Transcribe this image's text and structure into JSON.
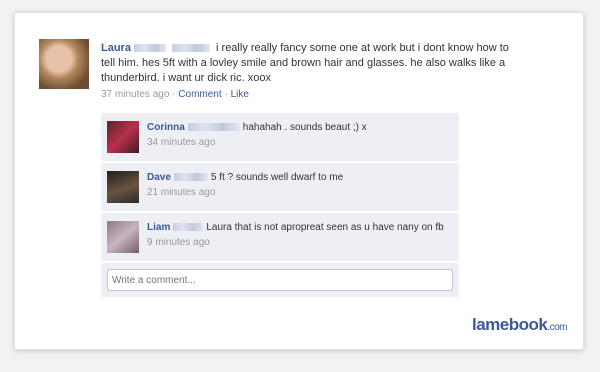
{
  "post": {
    "author": "Laura",
    "text": "i really really fancy some one at work but i dont know how to tell him. hes 5ft with a lovley smile and brown hair and glasses. he also walks like a thunderbird. i want ur dick ric. xoox",
    "time": "37 minutes ago",
    "separator": "·",
    "comment_link": "Comment",
    "like_link": "Like"
  },
  "comments": [
    {
      "author": "Corinna",
      "text": "hahahah . sounds beaut ;) x",
      "time": "34 minutes ago"
    },
    {
      "author": "Dave",
      "text": "5 ft ? sounds well dwarf to me",
      "time": "21 minutes ago"
    },
    {
      "author": "Liam",
      "text": "Laura that is not apropreat seen as u have nany on fb",
      "time": "9 minutes ago"
    }
  ],
  "write_comment": {
    "placeholder": "Write a comment..."
  },
  "logo": {
    "main": "lamebook",
    "suffix": ".com"
  }
}
